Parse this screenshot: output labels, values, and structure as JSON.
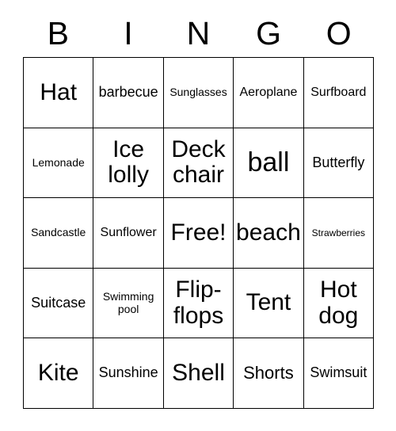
{
  "card": {
    "header_letters": [
      "B",
      "I",
      "N",
      "G",
      "O"
    ],
    "free_space_label": "Free!",
    "colors": {
      "background": "#ffffff",
      "border": "#000000",
      "text": "#000000"
    },
    "rows": [
      [
        {
          "label": "Hat",
          "size": "xxl"
        },
        {
          "label": "barbecue",
          "size": "ml"
        },
        {
          "label": "Sunglasses",
          "size": "sm"
        },
        {
          "label": "Aeroplane",
          "size": "md"
        },
        {
          "label": "Surfboard",
          "size": "md"
        }
      ],
      [
        {
          "label": "Lemonade",
          "size": "sm"
        },
        {
          "label": "Ice lolly",
          "size": "xxl"
        },
        {
          "label": "Deck chair",
          "size": "xxl"
        },
        {
          "label": "ball",
          "size": "max"
        },
        {
          "label": "Butterfly",
          "size": "ml"
        }
      ],
      [
        {
          "label": "Sandcastle",
          "size": "sm"
        },
        {
          "label": "Sunflower",
          "size": "md"
        },
        {
          "label": "Free!",
          "size": "xxl"
        },
        {
          "label": "beach",
          "size": "xxl"
        },
        {
          "label": "Strawberries",
          "size": "xs"
        }
      ],
      [
        {
          "label": "Suitcase",
          "size": "ml"
        },
        {
          "label": "Swimming pool",
          "size": "sm"
        },
        {
          "label": "Flip-flops",
          "size": "xxl"
        },
        {
          "label": "Tent",
          "size": "xxl"
        },
        {
          "label": "Hot dog",
          "size": "xxl"
        }
      ],
      [
        {
          "label": "Kite",
          "size": "xxl"
        },
        {
          "label": "Sunshine",
          "size": "ml"
        },
        {
          "label": "Shell",
          "size": "xxl"
        },
        {
          "label": "Shorts",
          "size": "lg"
        },
        {
          "label": "Swimsuit",
          "size": "ml"
        }
      ]
    ]
  }
}
